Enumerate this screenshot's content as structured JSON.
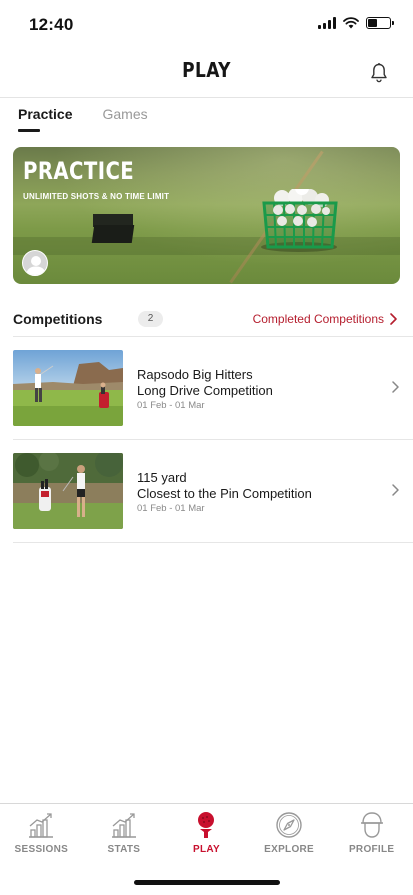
{
  "status_bar": {
    "time": "12:40",
    "battery_level": 0.45
  },
  "header": {
    "title": "PLAY",
    "bell_icon": "bell-icon"
  },
  "tabs": [
    {
      "label": "Practice",
      "active": true
    },
    {
      "label": "Games",
      "active": false
    }
  ],
  "banner": {
    "title": "PRACTICE",
    "subtitle": "UNLIMITED SHOTS & NO TIME LIMIT",
    "avatar_icon": "user-icon"
  },
  "competitions": {
    "title": "Competitions",
    "count": "2",
    "completed_link": "Completed Competitions",
    "items": [
      {
        "line1": "Rapsodo Big Hitters",
        "line2": "Long Drive Competition",
        "date": "01 Feb - 01 Mar"
      },
      {
        "line1": "115 yard",
        "line2": "Closest to the Pin Competition",
        "date": "01 Feb - 01 Mar"
      }
    ]
  },
  "bottom_nav": [
    {
      "label": "SESSIONS",
      "icon": "bar-chart-icon",
      "active": false
    },
    {
      "label": "STATS",
      "icon": "bar-chart-icon",
      "active": false
    },
    {
      "label": "PLAY",
      "icon": "golf-ball-tee-icon",
      "active": true
    },
    {
      "label": "EXPLORE",
      "icon": "compass-icon",
      "active": false
    },
    {
      "label": "PROFILE",
      "icon": "golfer-head-icon",
      "active": false
    }
  ],
  "colors": {
    "accent": "#c8102e",
    "link": "#b51e2e",
    "inactive": "#888888"
  }
}
